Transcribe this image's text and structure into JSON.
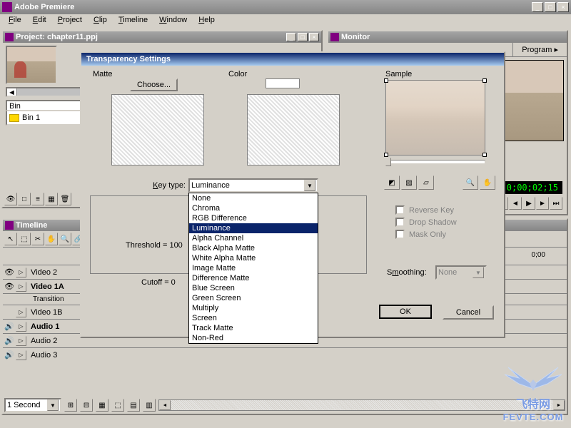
{
  "app": {
    "title": "Adobe Premiere"
  },
  "menu": {
    "items": [
      "File",
      "Edit",
      "Project",
      "Clip",
      "Timeline",
      "Window",
      "Help"
    ]
  },
  "project": {
    "title": "Project: chapter11.ppj",
    "bin_root": "Bin",
    "bin1": "Bin 1"
  },
  "monitor": {
    "title": "Monitor",
    "tab": "Program",
    "timecode": "0;00;02;15"
  },
  "timeline": {
    "title": "Timeline",
    "tracks": {
      "video2": "Video 2",
      "video1a": "Video 1A",
      "transition": "Transition",
      "video1b": "Video 1B",
      "audio1": "Audio 1",
      "audio2": "Audio 2",
      "audio3": "Audio 3"
    },
    "zoom": "1 Second",
    "ruler": "0;00"
  },
  "dialog": {
    "title": "Transparency Settings",
    "matte": {
      "label": "Matte",
      "choose_btn": "Choose..."
    },
    "color": {
      "label": "Color"
    },
    "sample": {
      "label": "Sample"
    },
    "key_type": {
      "label": "Key type:",
      "selected": "Luminance",
      "options": [
        "None",
        "Chroma",
        "RGB Difference",
        "Luminance",
        "Alpha Channel",
        "Black Alpha Matte",
        "White Alpha Matte",
        "Image Matte",
        "Difference Matte",
        "Blue Screen",
        "Green Screen",
        "Multiply",
        "Screen",
        "Track Matte",
        "Non-Red"
      ]
    },
    "threshold_label": "Threshold = 100",
    "cutoff_label": "Cutoff = 0",
    "checkboxes": {
      "reverse": "Reverse Key",
      "drop_shadow": "Drop Shadow",
      "mask_only": "Mask Only"
    },
    "smoothing": {
      "label": "Smoothing:",
      "value": "None"
    },
    "ok_btn": "OK",
    "cancel_btn": "Cancel"
  },
  "watermark": {
    "line1": "飞特网",
    "line2": "FEVTE.COM"
  }
}
